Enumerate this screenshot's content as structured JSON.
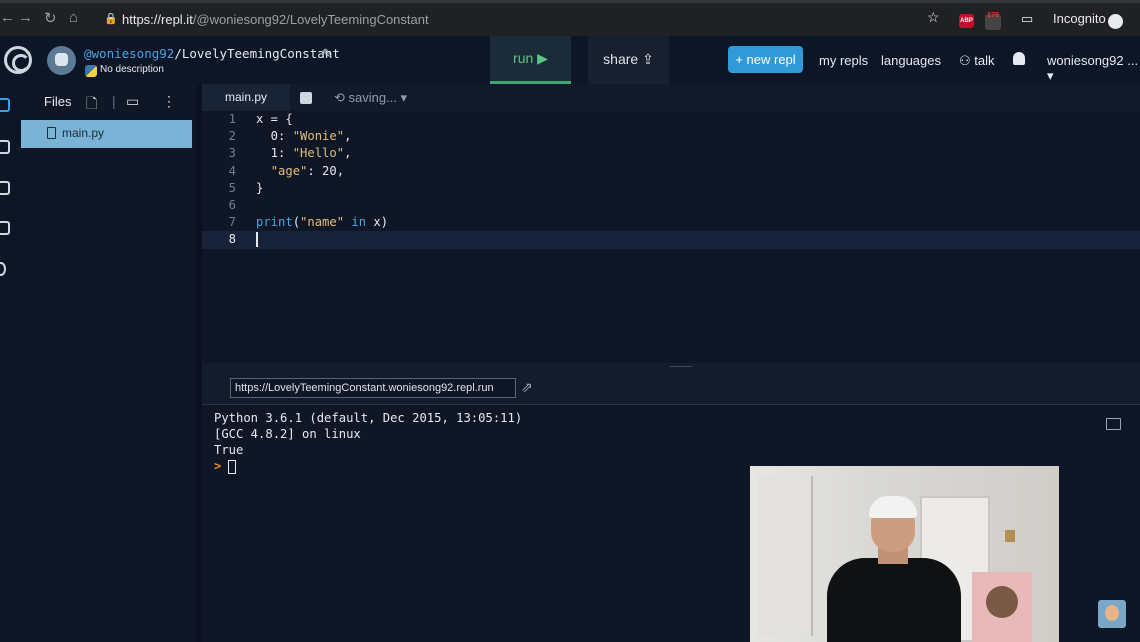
{
  "browser": {
    "url_host": "https://repl.it",
    "url_path": "/@woniesong92/LovelyTeemingConstant",
    "abp_label": "ABP",
    "ext_badge": "178",
    "incognito_label": "Incognito"
  },
  "header": {
    "user": "@woniesong92",
    "repl_name": "/LovelyTeemingConstant",
    "description": "No description",
    "run_label": "run ▶",
    "share_label": "share",
    "new_repl_label": "+ new repl",
    "nav": [
      "my repls",
      "languages",
      "talk"
    ],
    "account_label": "woniesong92 ..."
  },
  "files_panel": {
    "title": "Files",
    "files": [
      "main.py"
    ]
  },
  "editor": {
    "tab_label": "main.py",
    "status": "saving...",
    "lines": [
      {
        "n": "1",
        "code": "x = {"
      },
      {
        "n": "2",
        "code": "  0: \"Wonie\","
      },
      {
        "n": "3",
        "code": "  1: \"Hello\","
      },
      {
        "n": "4",
        "code": "  \"age\": 20,"
      },
      {
        "n": "5",
        "code": "}"
      },
      {
        "n": "6",
        "code": ""
      },
      {
        "n": "7",
        "code": "print(\"name\" in x)"
      },
      {
        "n": "8",
        "code": ""
      }
    ],
    "active_line": 8
  },
  "console": {
    "run_url": "https://LovelyTeemingConstant.woniesong92.repl.run",
    "output": [
      "Python 3.6.1 (default, Dec 2015, 13:05:11)",
      "[GCC 4.8.2] on linux",
      "True"
    ],
    "prompt": ">"
  },
  "colors": {
    "accent_blue": "#2f9ad7",
    "run_green": "#58c77f",
    "keyword": "#4aa3df",
    "string": "#e2bd7d",
    "background": "#0f1727"
  }
}
